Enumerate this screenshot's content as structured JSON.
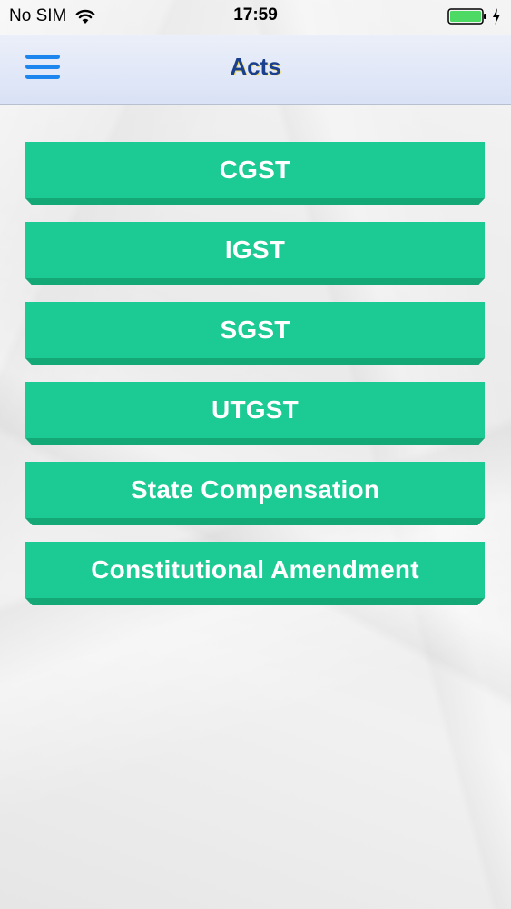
{
  "status_bar": {
    "carrier": "No SIM",
    "time": "17:59",
    "wifi_icon": "wifi-icon",
    "battery_icon": "battery-icon",
    "charge_icon": "charging-bolt-icon",
    "battery_color": "#4cd964"
  },
  "nav": {
    "title": "Acts",
    "menu_icon": "hamburger-menu-icon",
    "accent": "#1c86ee"
  },
  "acts": [
    {
      "label": "CGST"
    },
    {
      "label": "IGST"
    },
    {
      "label": "SGST"
    },
    {
      "label": "UTGST"
    },
    {
      "label": "State Compensation"
    },
    {
      "label": "Constitutional Amendment"
    }
  ],
  "colors": {
    "button": "#1ccb94",
    "button_edge": "#14a877",
    "title": "#1b3f8f"
  }
}
